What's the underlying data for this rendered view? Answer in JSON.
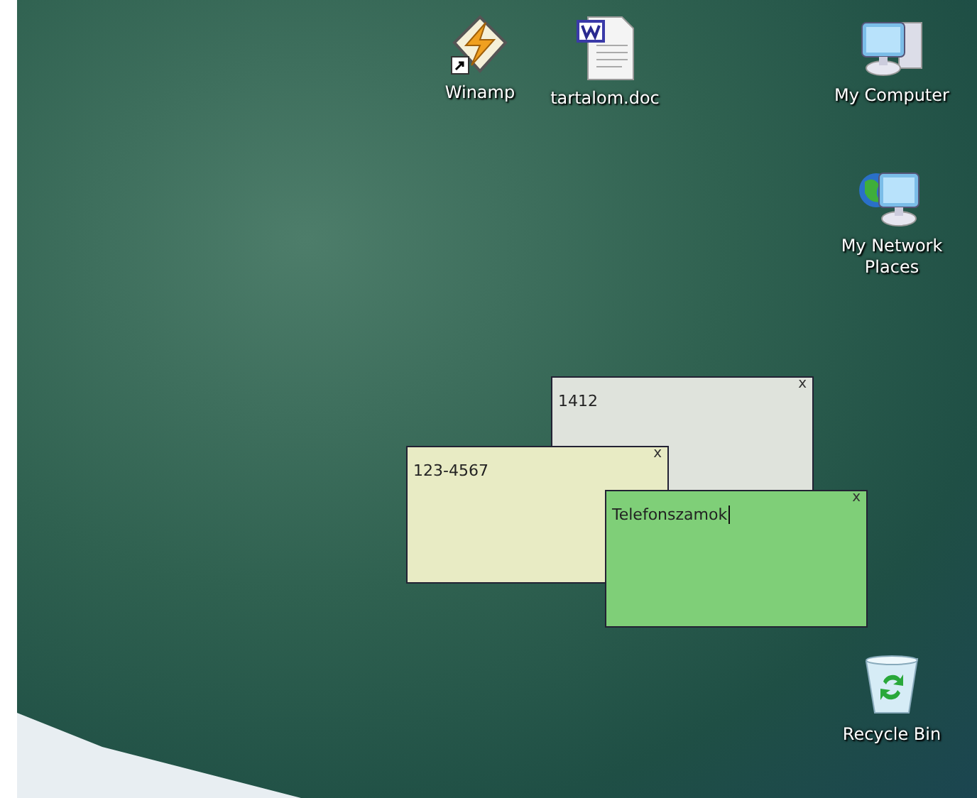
{
  "desktop_icons": [
    {
      "kind": "winamp",
      "label": "Winamp"
    },
    {
      "kind": "document",
      "label": "tartalom.doc"
    },
    {
      "kind": "computer",
      "label": "My Computer"
    },
    {
      "kind": "network",
      "label": "My Network Places"
    },
    {
      "kind": "recycle",
      "label": "Recycle Bin"
    }
  ],
  "sticky_notes": [
    {
      "text": "1412",
      "close": "x",
      "color": "#dfe3dc",
      "focused": false
    },
    {
      "text": "123-4567",
      "close": "x",
      "color": "#e8ebc4",
      "focused": false
    },
    {
      "text": "Telefonszamok",
      "close": "x",
      "color": "#7fcf78",
      "focused": true
    }
  ]
}
